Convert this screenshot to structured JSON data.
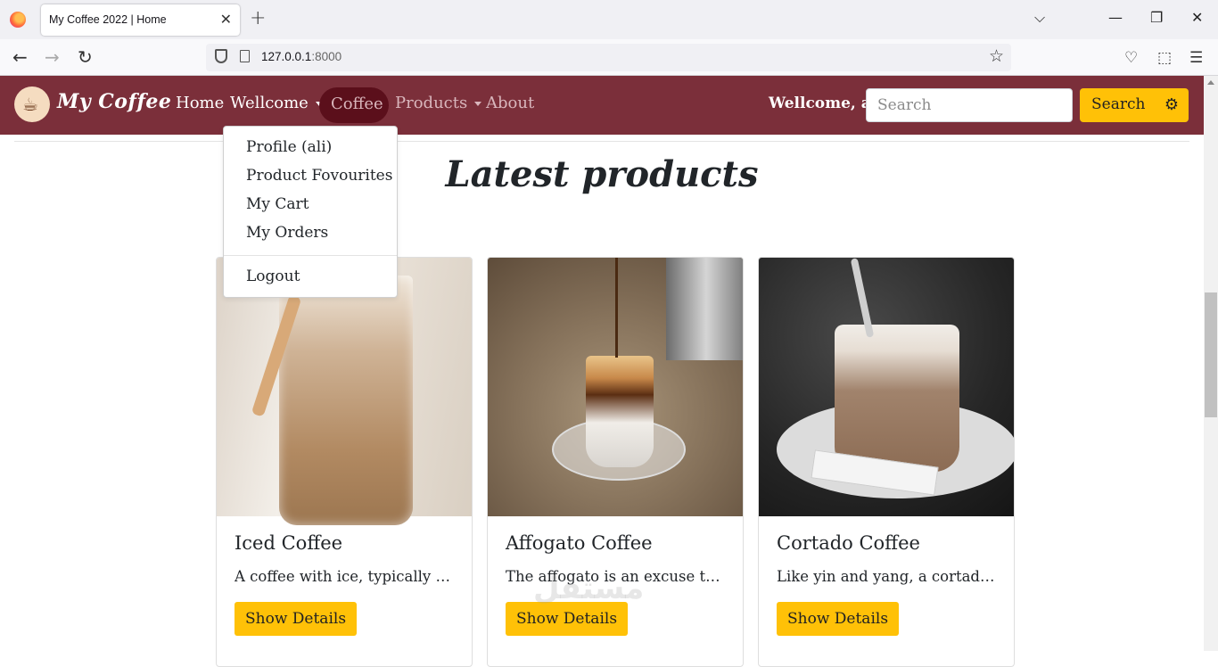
{
  "browser": {
    "tab_title": "My Coffee 2022 | Home",
    "tab_close": "✕",
    "new_tab": "+",
    "url_host": "127.0.0.1",
    "url_port": ":8000",
    "back": "←",
    "forward": "→",
    "reload": "↻",
    "star": "☆",
    "window_controls": {
      "list": "⌵",
      "minimize": "—",
      "restore": "❐",
      "close": "✕"
    },
    "toolbar_icons": {
      "pocket": "♡",
      "extensions": "⬚",
      "menu": "☰"
    }
  },
  "navbar": {
    "brand": "My Coffee",
    "brand_cup": "☕",
    "links": {
      "home": "Home",
      "wellcome": "Wellcome",
      "coffee": "Coffee",
      "products": "Products",
      "about": "About"
    },
    "user_greeting": "Wellcome, ali",
    "search_placeholder": "Search",
    "search_button": "Search",
    "settings_icon": "⚙"
  },
  "dropdown": {
    "items": [
      "Profile (ali)",
      "Product Fovourites",
      "My Cart",
      "My Orders"
    ],
    "logout": "Logout"
  },
  "page": {
    "title": "Latest products"
  },
  "products": [
    {
      "name": "Iced Coffee",
      "description": "A coffee with ice, typically served with a dash of milk",
      "button": "Show Details"
    },
    {
      "name": "Affogato Coffee",
      "description": "The affogato is an excuse to indulge in a scoop of ice cream",
      "button": "Show Details"
    },
    {
      "name": "Cortado Coffee",
      "description": "Like yin and yang, a cortado is the perfect balance",
      "button": "Show Details"
    }
  ],
  "watermark": "مستقل"
}
